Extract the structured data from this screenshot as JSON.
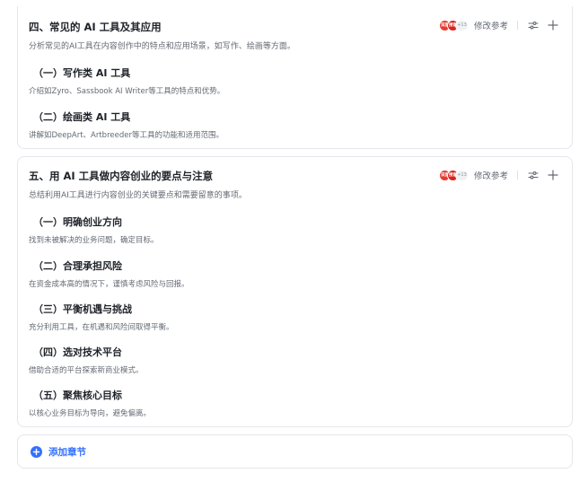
{
  "sections": [
    {
      "title": "四、常见的 AI 工具及其应用",
      "description": "分析常见的AI工具在内容创作中的特点和应用场景，如写作、绘画等方面。",
      "toolbar": {
        "avatar_a": "深度",
        "avatar_b": "搜索",
        "avatar_more": "+13",
        "ref_label": "修改参考"
      },
      "subsections": [
        {
          "title": "（一）写作类 AI 工具",
          "description": "介绍如Zyro、Sassbook AI Writer等工具的特点和优势。"
        },
        {
          "title": "（二）绘画类 AI 工具",
          "description": "讲解如DeepArt、Artbreeder等工具的功能和适用范围。"
        }
      ]
    },
    {
      "title": "五、用 AI 工具做内容创业的要点与注意",
      "description": "总结利用AI工具进行内容创业的关键要点和需要留意的事项。",
      "toolbar": {
        "avatar_a": "深度",
        "avatar_b": "搜索",
        "avatar_more": "+13",
        "ref_label": "修改参考"
      },
      "subsections": [
        {
          "title": "（一）明确创业方向",
          "description": "找到未被解决的业务问题，确定目标。"
        },
        {
          "title": "（二）合理承担风险",
          "description": "在资金成本高的情况下，谨慎考虑风险与回报。"
        },
        {
          "title": "（三）平衡机遇与挑战",
          "description": "充分利用工具，在机遇和风险间取得平衡。"
        },
        {
          "title": "（四）选对技术平台",
          "description": "借助合适的平台探索新商业模式。"
        },
        {
          "title": "（五）聚焦核心目标",
          "description": "以核心业务目标为导向，避免偏离。"
        }
      ]
    }
  ],
  "add_section_label": "添加章节",
  "colors": {
    "accent": "#3370ff",
    "avatar_red": "#e63b2e",
    "text_primary": "#1f2329",
    "text_secondary": "#646a73",
    "border": "#e4e6ea"
  },
  "icons": {
    "settings": "sliders-icon",
    "add": "plus-icon",
    "add_section": "plus-circle-icon"
  }
}
